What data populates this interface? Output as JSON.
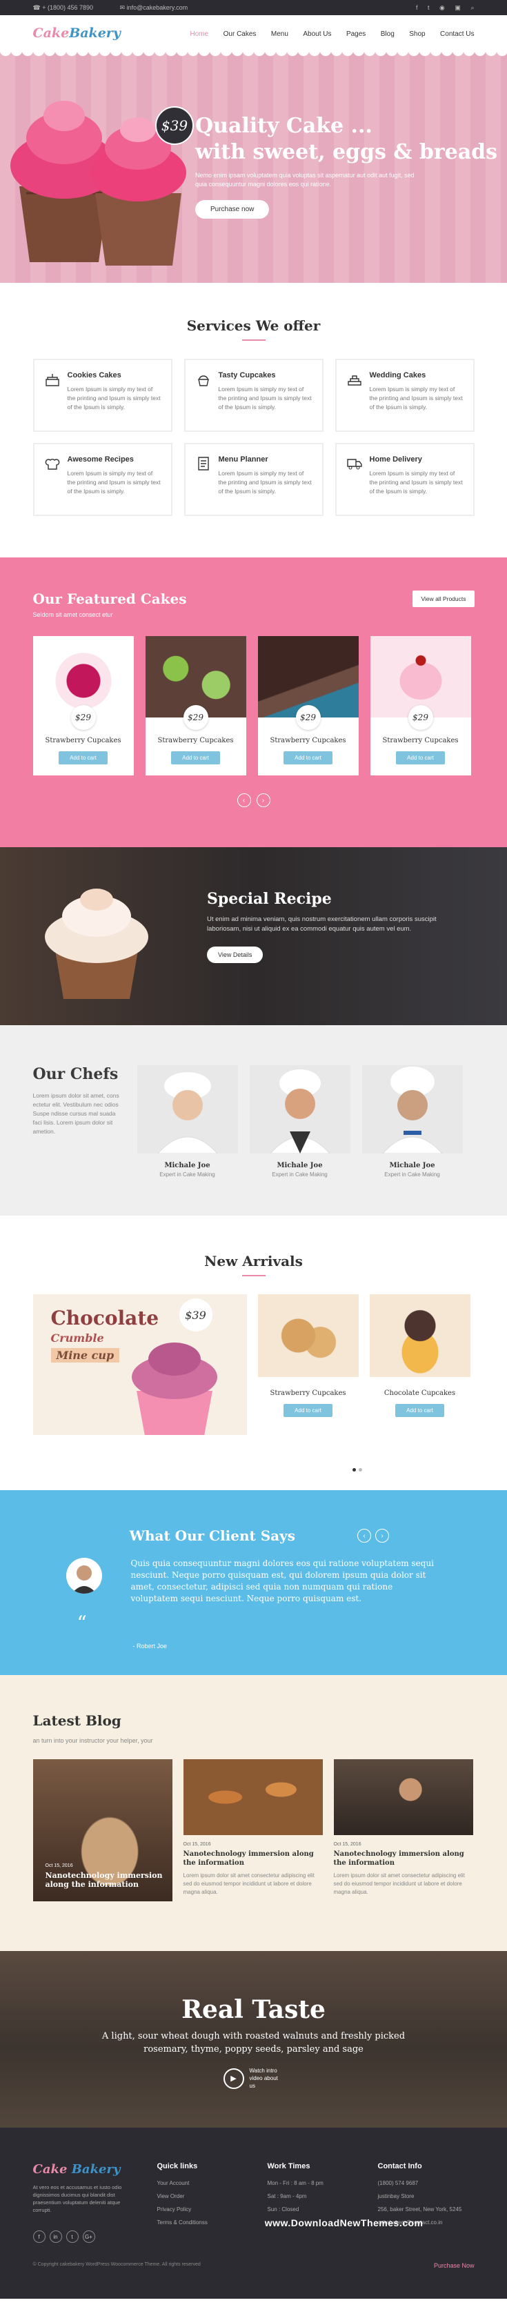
{
  "topbar": {
    "phone": "+ (1800) 456 7890",
    "email": "info@cakebakery.com"
  },
  "brand": {
    "a": "Cake",
    "b": "Bakery"
  },
  "nav": [
    "Home",
    "Our Cakes",
    "Menu",
    "About Us",
    "Pages",
    "Blog",
    "Shop",
    "Contact Us"
  ],
  "hero": {
    "price": "$39",
    "title1": "Quality Cake ...",
    "title2": "with sweet, eggs & breads",
    "text": "Nemo enim ipsam voluptatem quia voluptas sit aspernatur aut odit aut fugit, sed quia consequuntur magni dolores eos qui ratione.",
    "cta": "Purchase now"
  },
  "services": {
    "title": "Services We offer",
    "items": [
      {
        "title": "Cookies Cakes",
        "text": "Lorem Ipsum is simply my text of the printing and Ipsum is simply text of the Ipsum is simply."
      },
      {
        "title": "Tasty Cupcakes",
        "text": "Lorem Ipsum is simply my text of the printing and Ipsum is simply text of the Ipsum is simply."
      },
      {
        "title": "Wedding Cakes",
        "text": "Lorem Ipsum is simply my text of the printing and Ipsum is simply text of the Ipsum is simply."
      },
      {
        "title": "Awesome Recipes",
        "text": "Lorem Ipsum is simply my text of the printing and Ipsum is simply text of the Ipsum is simply."
      },
      {
        "title": "Menu Planner",
        "text": "Lorem Ipsum is simply my text of the printing and Ipsum is simply text of the Ipsum is simply."
      },
      {
        "title": "Home Delivery",
        "text": "Lorem Ipsum is simply my text of the printing and Ipsum is simply text of the Ipsum is simply."
      }
    ]
  },
  "featured": {
    "title": "Our Featured Cakes",
    "sub": "Seldom sit amet consect etur",
    "button": "View all Products",
    "cards": [
      {
        "price": "$29",
        "name": "Strawberry Cupcakes",
        "btn": "Add to cart"
      },
      {
        "price": "$29",
        "name": "Strawberry Cupcakes",
        "btn": "Add to cart"
      },
      {
        "price": "$29",
        "name": "Strawberry Cupcakes",
        "btn": "Add to cart"
      },
      {
        "price": "$29",
        "name": "Strawberry Cupcakes",
        "btn": "Add to cart"
      }
    ],
    "prev": "‹",
    "next": "›"
  },
  "special": {
    "title": "Special Recipe",
    "text": "Ut enim ad minima veniam, quis nostrum exercitationem ullam corporis suscipit laboriosam, nisi ut aliquid ex ea commodi equatur quis autem vel eum.",
    "button": "View Details"
  },
  "chefs": {
    "title": "Our Chefs",
    "text": "Lorem ipsum dolor sit amet, cons ectetur elit. Vestibulum nec odios Suspe ndisse cursus mal suada faci lisis. Lorem ipsum dolor sit ametion.",
    "items": [
      {
        "name": "Michale Joe",
        "role": "Expert in Cake Making"
      },
      {
        "name": "Michale Joe",
        "role": "Expert in Cake Making"
      },
      {
        "name": "Michale Joe",
        "role": "Expert in Cake Making"
      }
    ]
  },
  "arrivals": {
    "title": "New Arrivals",
    "main": {
      "w1": "Chocolate",
      "w2": "Crumble",
      "w3": "Mine cup",
      "price": "$39"
    },
    "cards": [
      {
        "price": "$29",
        "name": "Strawberry Cupcakes",
        "btn": "Add to cart"
      },
      {
        "price": "$29",
        "name": "Chocolate Cupcakes",
        "btn": "Add to cart"
      }
    ]
  },
  "testimonial": {
    "title": "What Our Client Says",
    "prev": "‹",
    "next": "›",
    "quote": "Quis quia consequuntur magni dolores eos qui ratione voluptatem sequi nesciunt. Neque porro quisquam est, qui dolorem ipsum quia dolor sit amet, consectetur, adipisci sed quia non numquam qui ratione voluptatem sequi nesciunt. Neque porro quisquam est.",
    "quote_mark": "“",
    "author": "- Robert Joe"
  },
  "blog": {
    "title": "Latest Blog",
    "sub": "an turn into your instructor your helper, your",
    "posts": [
      {
        "date": "Oct 15, 2016",
        "title": "Nanotechnology immersion along the information",
        "text": ""
      },
      {
        "date": "Oct 15, 2016",
        "title": "Nanotechnology immersion along the information",
        "text": "Lorem ipsum dolor sit amet consectetur adipiscing elit sed do eiusmod tempor incididunt ut labore et dolore magna aliqua."
      },
      {
        "date": "Oct 15, 2016",
        "title": "Nanotechnology immersion along the information",
        "text": "Lorem ipsum dolor sit amet consectetur adipiscing elit sed do eiusmod tempor incididunt ut labore et dolore magna aliqua."
      }
    ]
  },
  "taste": {
    "title": "Real Taste",
    "text": "A light, sour wheat dough with roasted walnuts and freshly picked rosemary, thyme, poppy seeds, parsley and sage",
    "video": "Watch intro video about us"
  },
  "footer": {
    "about": "At vero eos et accusamus et iusto odio dignissimos ducimus qui blandit dist praesentium voluptatum deleniti atque corrupti.",
    "social": [
      "f",
      "in",
      "t",
      "G+"
    ],
    "links_title": "Quick links",
    "links": [
      "Your Account",
      "View Order",
      "Privacy Policy",
      "Terms & Conditionss"
    ],
    "hours_title": "Work Times",
    "hours": [
      "Mon - Fri : 8 am - 8 pm",
      "Sat : 9am - 4pm",
      "Sun : Closed"
    ],
    "contact_title": "Contact Info",
    "contact": [
      "(1800) 574 9687",
      "justinbay Store",
      "256, baker Street, New York, 5245",
      "cakebakery@contact.co.in"
    ],
    "copyright": "© Copyright cakebakery WordPress Woocommerce Theme. All rights reserved",
    "purchase": "Purchase Now",
    "watermark": "www.DownloadNewThemes.com"
  },
  "colors": {
    "pink": "#f27ea4",
    "blue": "#5bbce7",
    "dark": "#2b2b31",
    "cream": "#f6efe2"
  }
}
